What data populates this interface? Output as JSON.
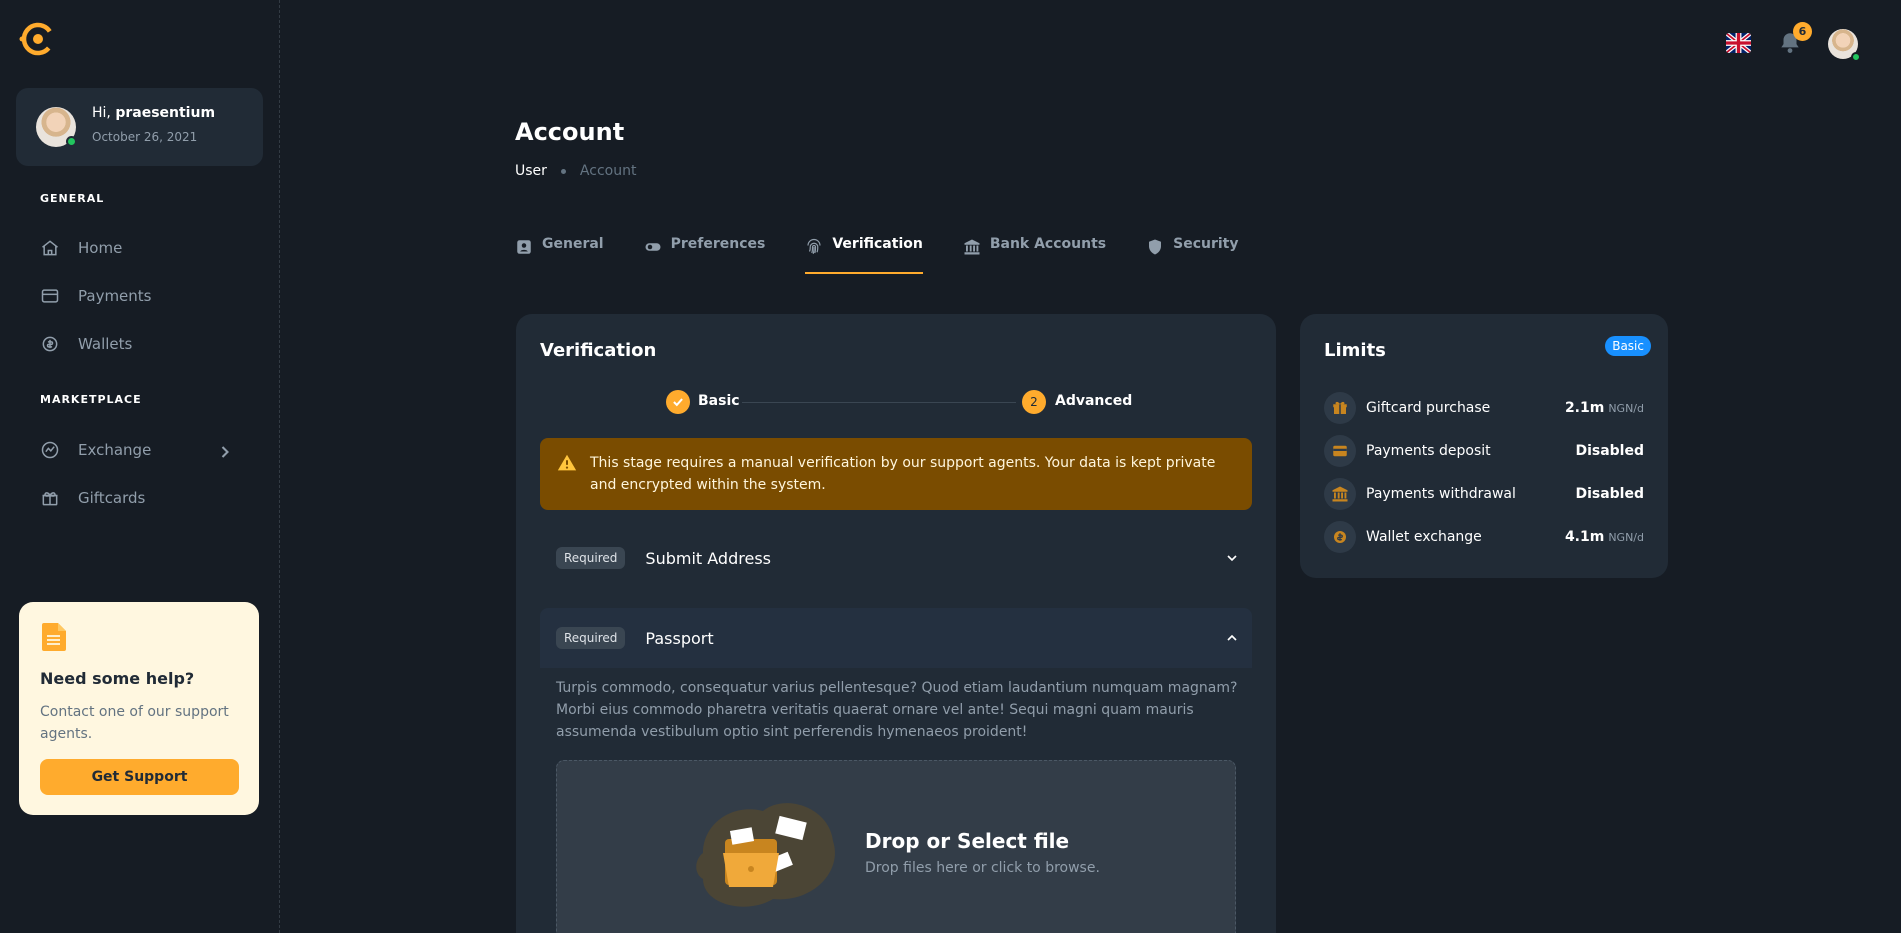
{
  "user": {
    "greeting_prefix": "Hi, ",
    "name": "praesentium",
    "date": "October 26, 2021"
  },
  "sidebar": {
    "sections": [
      {
        "title": "GENERAL",
        "items": [
          {
            "label": "Home",
            "icon": "home-icon"
          },
          {
            "label": "Payments",
            "icon": "card-icon"
          },
          {
            "label": "Wallets",
            "icon": "coins-icon"
          }
        ]
      },
      {
        "title": "MARKETPLACE",
        "items": [
          {
            "label": "Exchange",
            "icon": "chart-icon",
            "has_children": true
          },
          {
            "label": "Giftcards",
            "icon": "gift-icon"
          }
        ]
      }
    ],
    "help": {
      "title": "Need some help?",
      "text": "Contact one of our support agents.",
      "button": "Get Support"
    }
  },
  "header": {
    "notifications_count": "6",
    "language_flag": "uk-flag-icon"
  },
  "page": {
    "title": "Account",
    "breadcrumb": [
      "User",
      "Account"
    ],
    "tabs": [
      {
        "label": "General",
        "icon": "id-card-icon"
      },
      {
        "label": "Preferences",
        "icon": "toggle-icon"
      },
      {
        "label": "Verification",
        "icon": "fingerprint-icon",
        "active": true
      },
      {
        "label": "Bank Accounts",
        "icon": "bank-icon"
      },
      {
        "label": "Security",
        "icon": "shield-icon"
      }
    ]
  },
  "verification": {
    "title": "Verification",
    "steps": [
      {
        "label": "Basic",
        "status": "done"
      },
      {
        "label": "Advanced",
        "number": "2"
      }
    ],
    "alert": "This stage requires a manual verification by our support agents. Your data is kept private and encrypted within the system.",
    "sections": [
      {
        "tag": "Required",
        "label": "Submit Address",
        "expanded": false
      },
      {
        "tag": "Required",
        "label": "Passport",
        "expanded": true
      }
    ],
    "passport_text": "Turpis commodo, consequatur varius pellentesque? Quod etiam laudantium numquam magnam? Morbi eius commodo pharetra veritatis quaerat ornare vel ante! Sequi magni quam mauris assumenda vestibulum optio sint perferendis hymenaeos proident!",
    "dropzone": {
      "title": "Drop or Select file",
      "subtitle": "Drop files here or click to browse."
    }
  },
  "limits": {
    "title": "Limits",
    "badge": "Basic",
    "rows": [
      {
        "name": "Giftcard purchase",
        "value": "2.1m",
        "unit": "NGN/d",
        "icon": "gift-icon"
      },
      {
        "name": "Payments deposit",
        "value": "Disabled",
        "unit": "",
        "icon": "card-icon"
      },
      {
        "name": "Payments withdrawal",
        "value": "Disabled",
        "unit": "",
        "icon": "bank-icon"
      },
      {
        "name": "Wallet exchange",
        "value": "4.1m",
        "unit": "NGN/d",
        "icon": "coins-icon"
      }
    ]
  },
  "colors": {
    "accent": "#ffab2d",
    "background": "#161c24",
    "card": "#212b36",
    "info": "#1890ff",
    "success": "#22c55e",
    "warning_bg": "#7a4c00"
  }
}
